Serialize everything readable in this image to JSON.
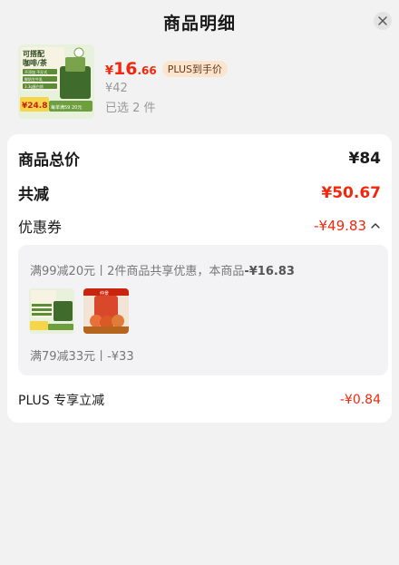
{
  "header": {
    "title": "商品明细"
  },
  "product": {
    "price_yen": "¥",
    "price_int": "16",
    "price_dec": ".66",
    "plus_badge": "PLUS到手价",
    "orig_price": "¥42",
    "selected": "已选 2 件",
    "thumb_text": {
      "line1": "可搭配",
      "line2": "咖啡/茶",
      "tag1": "不添加 不反式",
      "tag2": "鲜奶生牛乳",
      "tag3": "3.3g蛋白质",
      "price": "¥24.8",
      "promo": "每单满59 20元"
    }
  },
  "summary": {
    "total_label": "商品总价",
    "total_value": "¥84",
    "reduce_label": "共减",
    "reduce_value": "¥50.67",
    "coupon_label": "优惠券",
    "coupon_value": "-¥49.83",
    "plus_label": "PLUS 专享立减",
    "plus_value": "-¥0.84"
  },
  "coupon_detail": {
    "line1_pre": "满99减20元丨2件商品共享优惠，本商品",
    "line1_amount": "-¥16.83",
    "line2": "满79减33元丨-¥33",
    "thumb2_text": "仲景"
  },
  "colors": {
    "accent_red": "#f2270c",
    "badge_bg": "#fbe5cf"
  }
}
